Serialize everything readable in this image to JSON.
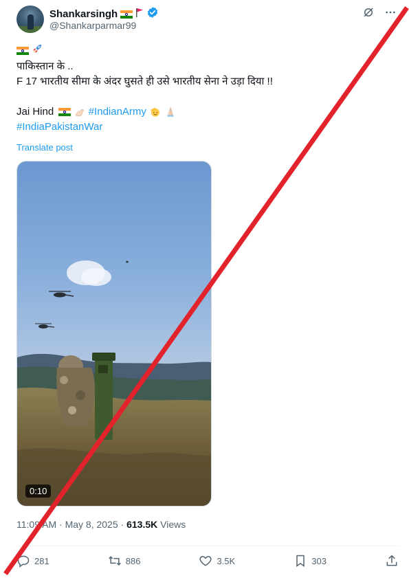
{
  "author": {
    "display_name": "Shankarsingh",
    "handle": "@Shankarparmar99",
    "verified": true
  },
  "post": {
    "line1_emojis": "🇮🇳🚀",
    "line2": "पाकिस्तान के ..",
    "line3": "F 17 भारतीय सीमा के अंदर घुसते ही उसे भारतीय सेना ने उड़ा दिया !!",
    "line4_prefix": "Jai Hind",
    "line4_hashtag": "#IndianArmy",
    "line5_hashtag": "#IndiaPakistanWar",
    "translate": "Translate post"
  },
  "media": {
    "duration": "0:10"
  },
  "meta": {
    "time": "11:09 AM",
    "separator": "·",
    "date": "May 8, 2025",
    "separator2": "·",
    "views_count": "613.5K",
    "views_label": "Views"
  },
  "actions": {
    "replies": "281",
    "reposts": "886",
    "likes": "3.5K",
    "bookmarks": "303"
  },
  "colors": {
    "accent": "#1d9bf0",
    "overlay_slash": "#e3232b",
    "secondary_text": "#536471"
  }
}
